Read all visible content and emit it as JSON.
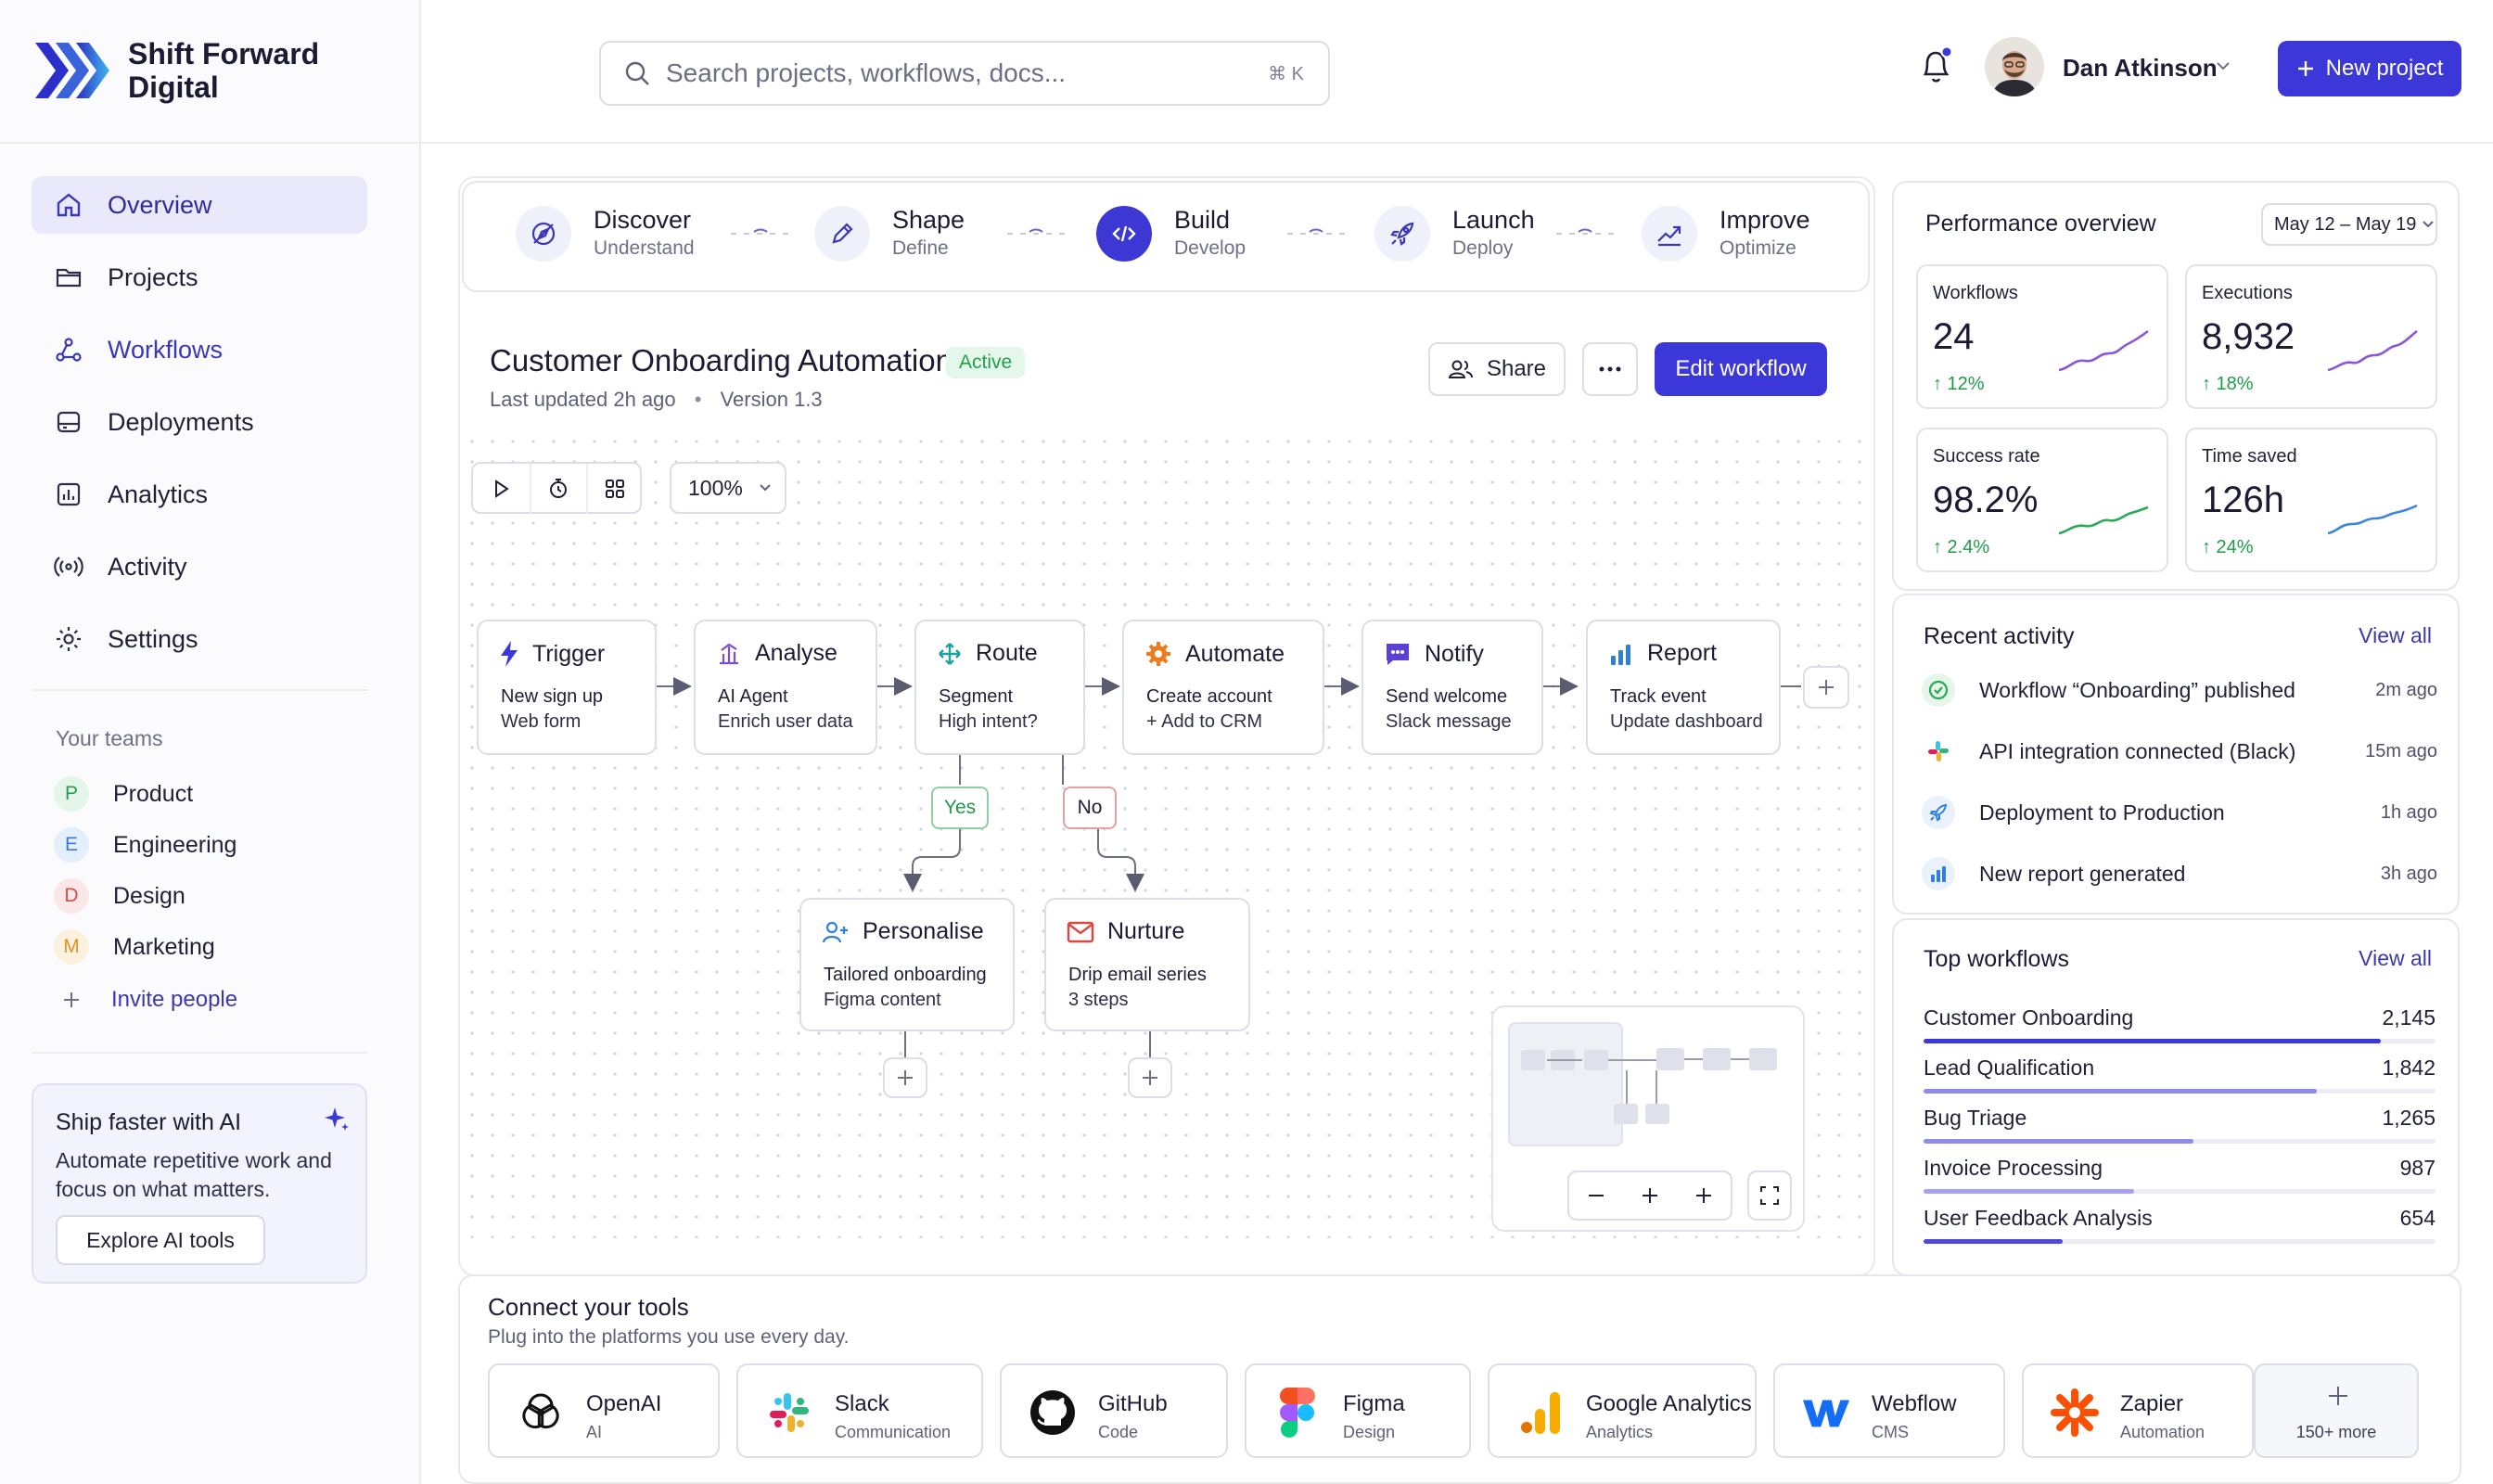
{
  "brand": {
    "name": "Shift Forward Digital"
  },
  "search": {
    "placeholder": "Search projects, workflows, docs...",
    "shortcut": "⌘ K"
  },
  "user": {
    "name": "Dan Atkinson"
  },
  "header": {
    "new_project_label": "New project"
  },
  "sidebar": {
    "nav": [
      {
        "label": "Overview",
        "icon": "home-icon"
      },
      {
        "label": "Projects",
        "icon": "folder-icon"
      },
      {
        "label": "Workflows",
        "icon": "workflow-icon"
      },
      {
        "label": "Deployments",
        "icon": "deploy-icon"
      },
      {
        "label": "Analytics",
        "icon": "chart-icon"
      },
      {
        "label": "Activity",
        "icon": "activity-icon"
      },
      {
        "label": "Settings",
        "icon": "gear-icon"
      }
    ],
    "teams_label": "Your teams",
    "teams": [
      {
        "initial": "P",
        "name": "Product",
        "bg": "#e4f6e9",
        "fg": "#2c9a52"
      },
      {
        "initial": "E",
        "name": "Engineering",
        "bg": "#e3effc",
        "fg": "#3a7ad8"
      },
      {
        "initial": "D",
        "name": "Design",
        "bg": "#fbe7e7",
        "fg": "#d44d4d"
      },
      {
        "initial": "M",
        "name": "Marketing",
        "bg": "#fcf1dc",
        "fg": "#d9952b"
      }
    ],
    "invite_label": "Invite people",
    "promo": {
      "title": "Ship faster with AI",
      "description": "Automate repetitive work and focus on what matters.",
      "button": "Explore AI tools"
    }
  },
  "stages": [
    {
      "name": "Discover",
      "sub": "Understand",
      "icon": "compass-icon"
    },
    {
      "name": "Shape",
      "sub": "Define",
      "icon": "pencil-icon"
    },
    {
      "name": "Build",
      "sub": "Develop",
      "icon": "code-icon"
    },
    {
      "name": "Launch",
      "sub": "Deploy",
      "icon": "rocket-icon"
    },
    {
      "name": "Improve",
      "sub": "Optimize",
      "icon": "trend-up-icon"
    }
  ],
  "workflow": {
    "title": "Customer Onboarding Automation",
    "status": "Active",
    "updated": "Last updated 2h ago",
    "separator": "•",
    "version": "Version 1.3",
    "share_label": "Share",
    "edit_label": "Edit workflow",
    "zoom": "100%"
  },
  "nodes": {
    "trigger": {
      "title": "Trigger",
      "l1": "New sign up",
      "l2": "Web form"
    },
    "analyse": {
      "title": "Analyse",
      "l1": "AI Agent",
      "l2": "Enrich user data"
    },
    "route": {
      "title": "Route",
      "l1": "Segment",
      "l2": "High intent?"
    },
    "automate": {
      "title": "Automate",
      "l1": "Create account",
      "l2": "+ Add to CRM"
    },
    "notify": {
      "title": "Notify",
      "l1": "Send welcome",
      "l2": "Slack message"
    },
    "report": {
      "title": "Report",
      "l1": "Track event",
      "l2": "Update dashboard"
    },
    "personalise": {
      "title": "Personalise",
      "l1": "Tailored onboarding",
      "l2": "Figma content"
    },
    "nurture": {
      "title": "Nurture",
      "l1": "Drip email series",
      "l2": "3 steps"
    }
  },
  "branches": {
    "yes": "Yes",
    "no": "No"
  },
  "performance": {
    "title": "Performance overview",
    "date_range": "May 12 – May 19",
    "metrics": [
      {
        "label": "Workflows",
        "value": "24",
        "delta": "↑ 12%",
        "color": "#7a4fd6"
      },
      {
        "label": "Executions",
        "value": "8,932",
        "delta": "↑ 18%",
        "color": "#7a4fd6"
      },
      {
        "label": "Success rate",
        "value": "98.2%",
        "delta": "↑ 2.4%",
        "color": "#2aa957"
      },
      {
        "label": "Time saved",
        "value": "126h",
        "delta": "↑ 24%",
        "color": "#3a86d9"
      }
    ]
  },
  "activity": {
    "title": "Recent activity",
    "view_all": "View all",
    "items": [
      {
        "text": "Workflow “Onboarding” published",
        "time": "2m ago",
        "icon": "check-circle-icon"
      },
      {
        "text": "API integration connected (Black)",
        "time": "15m ago",
        "icon": "slack-icon"
      },
      {
        "text": "Deployment to Production",
        "time": "1h ago",
        "icon": "rocket-icon"
      },
      {
        "text": "New report generated",
        "time": "3h ago",
        "icon": "bar-chart-icon"
      }
    ]
  },
  "top_workflows": {
    "title": "Top workflows",
    "view_all": "View all",
    "items": [
      {
        "name": "Customer Onboarding",
        "count": "2,145",
        "value": 2145,
        "color": "#3b37d8"
      },
      {
        "name": "Lead Qualification",
        "count": "1,842",
        "value": 1842,
        "color": "#8f8be6"
      },
      {
        "name": "Bug Triage",
        "count": "1,265",
        "value": 1265,
        "color": "#8f8be6"
      },
      {
        "name": "Invoice Processing",
        "count": "987",
        "value": 987,
        "color": "#a6a3ec"
      },
      {
        "name": "User Feedback Analysis",
        "count": "654",
        "value": 654,
        "color": "#4f4bd9"
      }
    ],
    "max": 2400
  },
  "tools": {
    "title": "Connect your tools",
    "subtitle": "Plug into the platforms you use every day.",
    "items": [
      {
        "name": "OpenAI",
        "category": "AI",
        "icon": "openai-icon"
      },
      {
        "name": "Slack",
        "category": "Communication",
        "icon": "slack-icon"
      },
      {
        "name": "GitHub",
        "category": "Code",
        "icon": "github-icon"
      },
      {
        "name": "Figma",
        "category": "Design",
        "icon": "figma-icon"
      },
      {
        "name": "Google Analytics",
        "category": "Analytics",
        "icon": "google-analytics-icon"
      },
      {
        "name": "Webflow",
        "category": "CMS",
        "icon": "webflow-icon"
      },
      {
        "name": "Zapier",
        "category": "Automation",
        "icon": "zapier-icon"
      }
    ],
    "more_label": "150+ more"
  }
}
